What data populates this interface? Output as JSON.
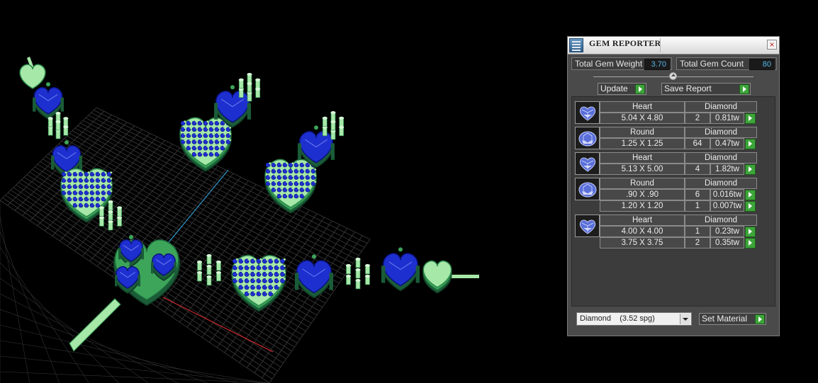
{
  "panel": {
    "title": "GEM REPORTER",
    "close_label": "×",
    "total_weight_label": "Total Gem Weight",
    "total_weight_value": "3.70",
    "total_count_label": "Total Gem Count",
    "total_count_value": "80",
    "update_label": "Update",
    "save_report_label": "Save Report",
    "material_select_value": "Diamond    (3.52 spg)",
    "set_material_label": "Set Material"
  },
  "gems": [
    {
      "shape": "Heart",
      "material": "Diamond",
      "icon": "heart-gem-icon",
      "sizes": [
        {
          "size": "5.04 X 4.80",
          "count": "2",
          "weight": "0.81tw"
        }
      ]
    },
    {
      "shape": "Round",
      "material": "Diamond",
      "icon": "round-gem-icon",
      "sizes": [
        {
          "size": "1.25 X 1.25",
          "count": "64",
          "weight": "0.47tw"
        }
      ]
    },
    {
      "shape": "Heart",
      "material": "Diamond",
      "icon": "heart-gem-icon",
      "sizes": [
        {
          "size": "5.13 X 5.00",
          "count": "4",
          "weight": "1.82tw"
        }
      ]
    },
    {
      "shape": "Round",
      "material": "Diamond",
      "icon": "round-gem-icon",
      "sizes": [
        {
          "size": ".90 X .90",
          "count": "6",
          "weight": "0.016tw"
        },
        {
          "size": "1.20 X 1.20",
          "count": "1",
          "weight": "0.007tw"
        }
      ]
    },
    {
      "shape": "Heart",
      "material": "Diamond",
      "icon": "heart-gem-icon",
      "sizes": [
        {
          "size": "4.00 X 4.00",
          "count": "1",
          "weight": "0.23tw"
        },
        {
          "size": "3.75 X 3.75",
          "count": "2",
          "weight": "0.35tw"
        }
      ]
    }
  ],
  "colors": {
    "metal_light": "#a6e8a8",
    "metal_mid": "#3ca55a",
    "metal_dark": "#1a5c38",
    "gem_blue": "#1e2fd0",
    "value_text": "#55b6e8",
    "play_green": "#3da53a"
  }
}
